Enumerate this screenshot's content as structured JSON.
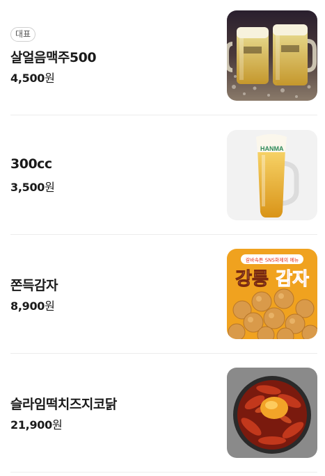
{
  "menu": {
    "items": [
      {
        "badge": "대표",
        "name": "살얼음맥주500",
        "price": "4,500",
        "currency": "원",
        "image_icon": "beer-mugs-photo"
      },
      {
        "badge": "",
        "name": "300cc",
        "price": "3,500",
        "currency": "원",
        "image_icon": "beer-glass-photo"
      },
      {
        "badge": "",
        "name": "쫀득감자",
        "price": "8,900",
        "currency": "원",
        "image_icon": "potato-balls-photo",
        "image_text": {
          "tagline": "갈바속튼 SNS화제의 메뉴",
          "title_left": "강릉",
          "title_right": "감자"
        }
      },
      {
        "badge": "",
        "name": "슬라임떡치즈지코닭",
        "price": "21,900",
        "currency": "원",
        "image_icon": "cheese-chicken-photo"
      }
    ],
    "glass_logo": "HANMA"
  },
  "colors": {
    "divider": "#ececec",
    "text": "#1a1a1a",
    "badge_border": "#cfcfcf",
    "potato_bg": "#f0a21f",
    "potato_title": "#e8301c"
  }
}
